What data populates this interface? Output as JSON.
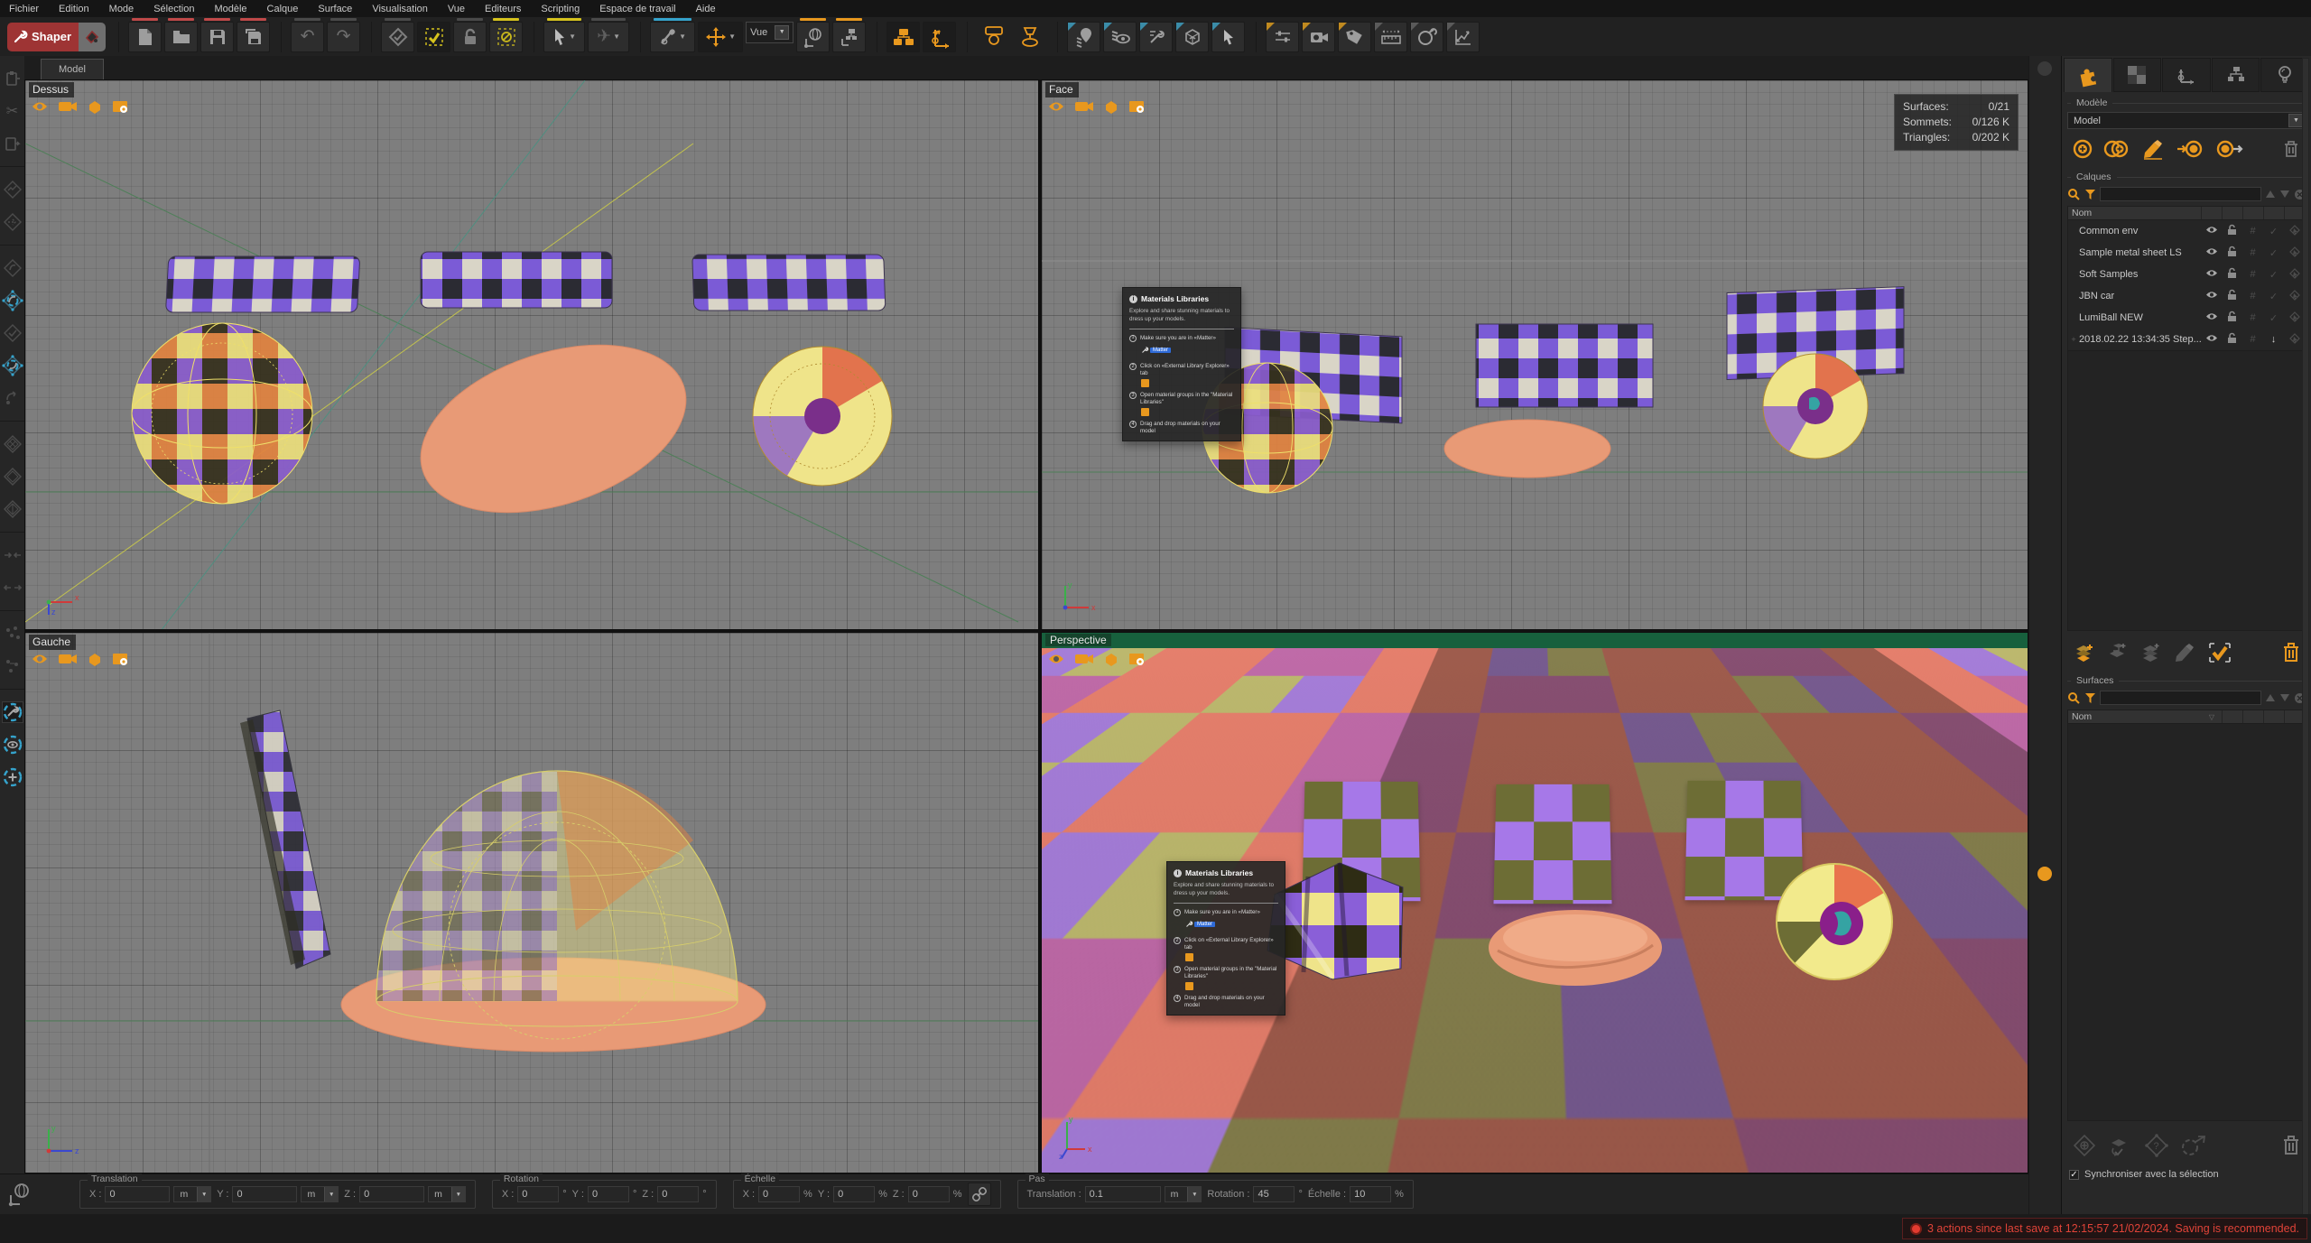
{
  "menu": {
    "items": [
      "Fichier",
      "Edition",
      "Mode",
      "Sélection",
      "Modèle",
      "Calque",
      "Surface",
      "Visualisation",
      "Vue",
      "Editeurs",
      "Scripting",
      "Espace de travail",
      "Aide"
    ]
  },
  "toolbar": {
    "shaper_label": "Shaper",
    "view_select_value": "Vue",
    "accent_colors": {
      "red": "#c14949",
      "yellow": "#d6c31d",
      "blue": "#35a3cc",
      "orange": "#e8981e"
    },
    "icons": [
      "paint-bucket-icon",
      "file-new-icon",
      "folder-open-icon",
      "save-icon",
      "save-as-icon",
      "undo-icon",
      "redo-icon",
      "schema-check-icon",
      "checkbox-select-icon",
      "lock-icon",
      "deselect-icon",
      "cursor-arrow-icon",
      "airplane-icon",
      "dig-tool-icon",
      "move-tool-icon",
      "globe-axes-icon",
      "schema-axes-icon",
      "link-items-icon",
      "axes-rig-icon",
      "lamp-front-icon",
      "lamp-top-icon",
      "pin-layers-icon",
      "eye-layers-icon",
      "wrench-list-icon",
      "render-box-icon",
      "cursor-pick-icon",
      "sliders-icon",
      "camera-icon",
      "tag-icon",
      "ruler-icon",
      "timer-wrench-icon",
      "graph-icon"
    ]
  },
  "tabs": {
    "model_tab": "Model"
  },
  "viewports": {
    "top": {
      "label": "Dessus"
    },
    "front": {
      "label": "Face",
      "stats": {
        "surfaces_label": "Surfaces:",
        "surfaces": "0/21",
        "vertices_label": "Sommets:",
        "vertices": "0/126 K",
        "triangles_label": "Triangles:",
        "triangles": "0/202 K"
      }
    },
    "left": {
      "label": "Gauche"
    },
    "perspective": {
      "label": "Perspective"
    },
    "tool_icons": [
      "eye-icon",
      "camera-icon",
      "cube-icon",
      "viewport-settings-icon"
    ]
  },
  "axis_labels": {
    "x": "x",
    "y": "y",
    "z": "z"
  },
  "materials_popup": {
    "title": "Materials Libraries",
    "subtitle": "Explore and share stunning materials to dress up your models.",
    "steps": [
      {
        "num": "1",
        "text": "Make sure you are in «Matter»",
        "badge": "Matter"
      },
      {
        "num": "2",
        "text": "Click on «External Library Explorer» tab"
      },
      {
        "num": "3",
        "text": "Open material groups in the \"Material Libraries\""
      },
      {
        "num": "4",
        "text": "Drag and drop materials on your model"
      }
    ]
  },
  "right_panel": {
    "tab_icons": [
      "puzzle-icon",
      "checker-icon",
      "axes-icon",
      "hierarchy-icon",
      "bulb-icon"
    ],
    "model_group_label": "Modèle",
    "model_value": "Model",
    "model_icons": [
      "add-item-icon",
      "duplicate-item-icon",
      "rename-icon",
      "import-ref-icon",
      "export-ref-icon",
      "delete-icon"
    ],
    "layers_group_label": "Calques",
    "search_icons": [
      "search-icon",
      "filter-icon",
      "up-icon",
      "down-icon",
      "clear-icon"
    ],
    "name_header": "Nom",
    "row_icons": [
      "visibility-icon",
      "lock-icon",
      "index-icon",
      "check-icon",
      "select-icon"
    ],
    "layers": [
      {
        "prefix": "",
        "name": "Common env"
      },
      {
        "prefix": "",
        "name": "Sample metal sheet LS"
      },
      {
        "prefix": "",
        "name": "Soft Samples"
      },
      {
        "prefix": "",
        "name": "JBN car"
      },
      {
        "prefix": "",
        "name": "LumiBall NEW"
      },
      {
        "prefix": "+",
        "name": "2018.02.22 13:34:35 Step..."
      }
    ],
    "layer_action_icons": [
      "add-layer-icon",
      "add-child-layer-icon",
      "add-layer-stack-icon",
      "rename-layer-icon",
      "select-all-icon",
      "delete-layer-icon"
    ],
    "surfaces_group_label": "Surfaces",
    "surfaces_name_header": "Nom",
    "surface_action_icons": [
      "new-surface-icon",
      "assign-surface-icon",
      "surface-info-icon",
      "detach-surface-icon",
      "delete-surface-icon"
    ],
    "sync_checkbox_label": "Synchroniser avec la sélection",
    "sync_checked": "✓"
  },
  "transform_bar": {
    "translation": {
      "label": "Translation",
      "fields": [
        {
          "axis": "X :",
          "value": "0",
          "unit": "m"
        },
        {
          "axis": "Y :",
          "value": "0",
          "unit": "m"
        },
        {
          "axis": "Z :",
          "value": "0",
          "unit": "m"
        }
      ]
    },
    "rotation": {
      "label": "Rotation",
      "fields": [
        {
          "axis": "X :",
          "value": "0",
          "suffix": "°"
        },
        {
          "axis": "Y :",
          "value": "0",
          "suffix": "°"
        },
        {
          "axis": "Z :",
          "value": "0",
          "suffix": "°"
        }
      ]
    },
    "scale": {
      "label": "Échelle",
      "fields": [
        {
          "axis": "X :",
          "value": "0",
          "suffix": "%"
        },
        {
          "axis": "Y :",
          "value": "0",
          "suffix": "%"
        },
        {
          "axis": "Z :",
          "value": "0",
          "suffix": "%"
        }
      ]
    },
    "step": {
      "label": "Pas",
      "translation_label": "Translation :",
      "translation_value": "0.1",
      "translation_unit": "m",
      "rotation_label": "Rotation :",
      "rotation_value": "45",
      "rotation_suffix": "°",
      "scale_label": "Échelle :",
      "scale_value": "10",
      "scale_suffix": "%"
    }
  },
  "status": {
    "message": "3 actions since last save at 12:15:57 21/02/2024. Saving is recommended.",
    "color": "#e04338"
  }
}
